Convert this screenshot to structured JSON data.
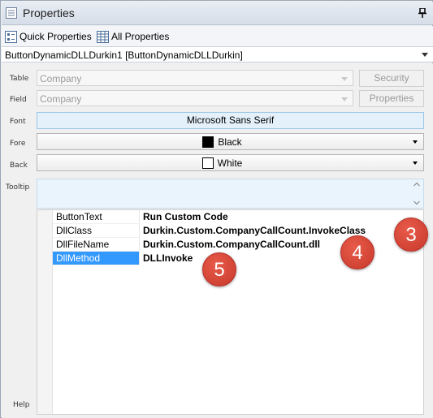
{
  "window": {
    "title": "Properties"
  },
  "toolbar": {
    "quick_properties": "Quick Properties",
    "all_properties": "All Properties"
  },
  "selector": {
    "value": "ButtonDynamicDLLDurkin1 [ButtonDynamicDLLDurkin]"
  },
  "form": {
    "table_label": "Table",
    "table_value": "Company",
    "security_button": "Security",
    "field_label": "Field",
    "field_value": "Company",
    "properties_button": "Properties",
    "font_label": "Font",
    "font_value": "Microsoft Sans Serif",
    "fore_label": "Fore",
    "fore_value": "Black",
    "fore_color": "#000000",
    "back_label": "Back",
    "back_value": "White",
    "back_color": "#ffffff",
    "tooltip_label": "Tooltip",
    "help_label": "Help"
  },
  "grid": {
    "rows": [
      {
        "key": "ButtonText",
        "value": "Run Custom Code",
        "selected": false
      },
      {
        "key": "DllClass",
        "value": "Durkin.Custom.CompanyCallCount.InvokeClass",
        "selected": false
      },
      {
        "key": "DllFileName",
        "value": "Durkin.Custom.CompanyCallCount.dll",
        "selected": false
      },
      {
        "key": "DllMethod",
        "value": "DLLInvoke",
        "selected": true
      }
    ]
  },
  "badges": {
    "b3": "3",
    "b4": "4",
    "b5": "5"
  },
  "colors": {
    "selection": "#3399ff",
    "badge": "#d9473a",
    "font_box": "#e4f1fb"
  }
}
